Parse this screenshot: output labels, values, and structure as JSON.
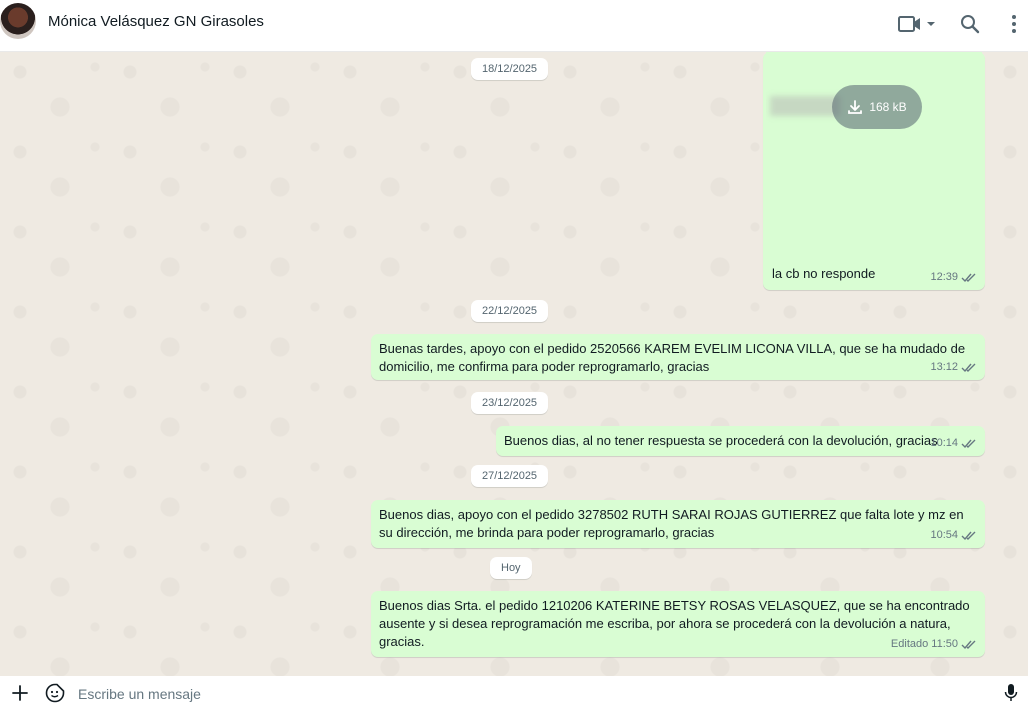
{
  "header": {
    "contact_name": "Mónica Velásquez GN Girasoles",
    "icons": {
      "avatar": "contact-photo",
      "video": "video-call-icon",
      "search": "search-icon",
      "menu": "kebab-menu-icon"
    }
  },
  "messages_area": {
    "image_message": {
      "download_size": "168 kB",
      "caption": "la cb no responde",
      "time": "12:39"
    },
    "date_chips": [
      "18/12/2025",
      "22/12/2025",
      "23/12/2025",
      "27/12/2025",
      "Hoy"
    ],
    "messages": [
      {
        "text": "Buenas tardes, apoyo con el pedido 2520566 KAREM EVELIM LICONA VILLA, que se ha mudado de domicilio, me confirma para poder reprogramarlo, gracias",
        "time": "13:12"
      },
      {
        "text": "Buenos dias, al no tener respuesta se procederá con la devolución, gracias",
        "time": "10:14"
      },
      {
        "text": "Buenos dias, apoyo con el pedido 3278502 RUTH SARAI ROJAS GUTIERREZ que falta lote y mz en su dirección, me brinda para poder reprogramarlo, gracias",
        "time": "10:54"
      },
      {
        "text": "Buenos dias Srta. el pedido 1210206 KATERINE BETSY ROSAS VELASQUEZ, que se ha encontrado ausente y si desea reprogramación me escriba, por ahora se procederá con la devolución a natura, gracias.",
        "time": "Editado 11:50"
      }
    ]
  },
  "composer": {
    "placeholder": "Escribe un mensaje",
    "icons": {
      "attach": "plus-icon",
      "emoji": "emoji-sticker-icon",
      "mic": "microphone-icon"
    }
  },
  "colors": {
    "outgoing_bubble": "#d9fdd3",
    "chat_background": "#efeae2",
    "tick": "#667781"
  }
}
